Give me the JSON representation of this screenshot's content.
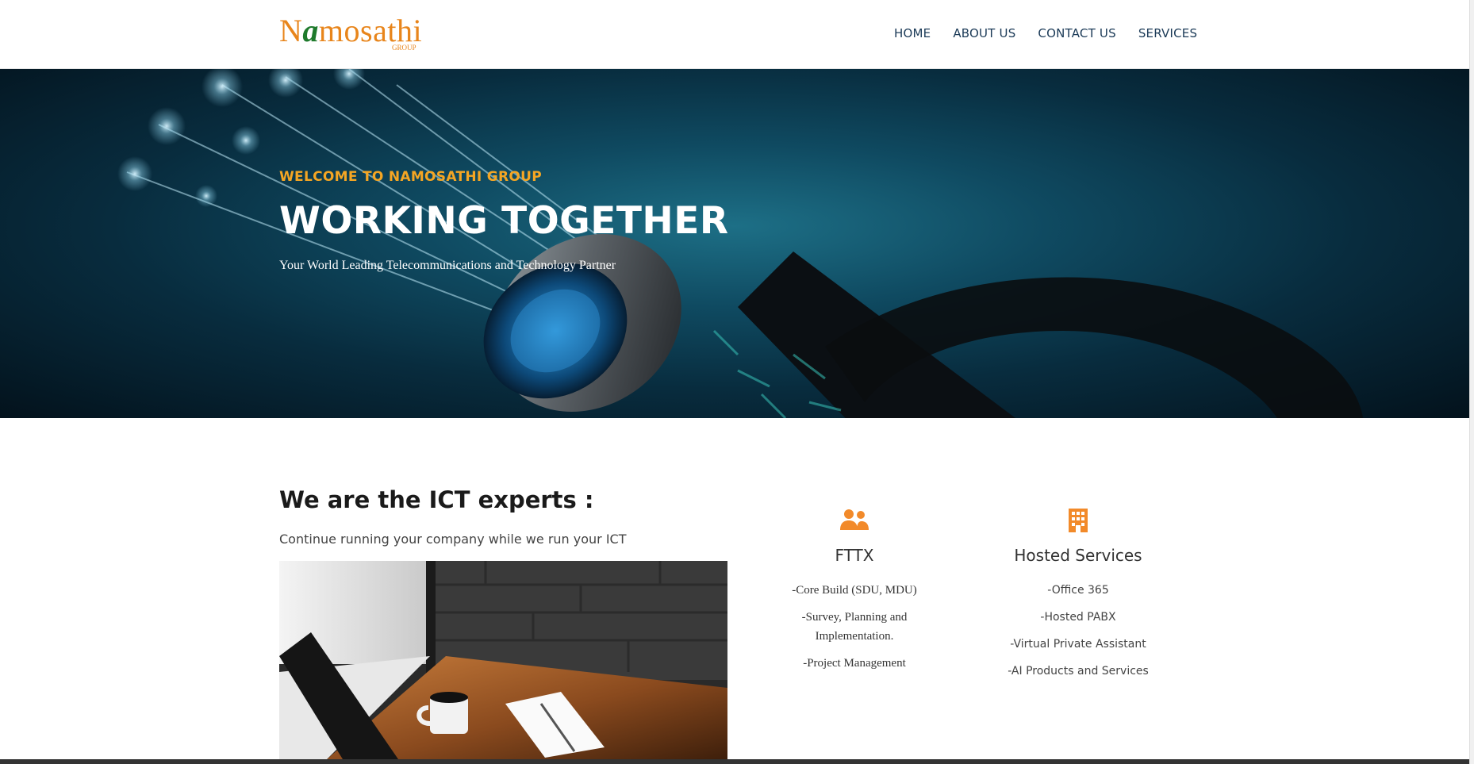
{
  "brand": {
    "logo_prefix": "N",
    "logo_accent": "a",
    "logo_rest": "mosathi",
    "logo_sub": "GROUP",
    "colors": {
      "orange": "#e8851b",
      "green": "#1e7a2c",
      "accent": "#f5a623",
      "nav": "#1b3a57"
    }
  },
  "nav": {
    "items": [
      {
        "label": "HOME"
      },
      {
        "label": "ABOUT US"
      },
      {
        "label": "CONTACT US"
      },
      {
        "label": "SERVICES"
      }
    ]
  },
  "hero": {
    "eyebrow": "WELCOME TO NAMOSATHI GROUP",
    "title": "WORKING TOGETHER",
    "tagline": "Your World Leading Telecommunications and Technology Partner"
  },
  "about": {
    "title": "We are the ICT experts :",
    "subtitle": "Continue running your company while we run your ICT"
  },
  "services": [
    {
      "icon": "users-icon",
      "title": "FTTX",
      "items": [
        "-Core Build (SDU, MDU)",
        "-Survey, Planning and Implementation.",
        "-Project Management"
      ]
    },
    {
      "icon": "building-icon",
      "title": "Hosted Services",
      "items": [
        "-Office 365",
        "-Hosted PABX",
        "-Virtual Private Assistant",
        "-AI Products and Services"
      ]
    }
  ]
}
